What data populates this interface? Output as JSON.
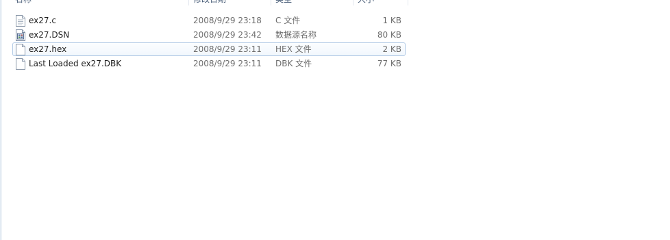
{
  "columns": {
    "name": "名称",
    "date": "修改日期",
    "type": "类型",
    "size": "大小"
  },
  "files": [
    {
      "name": "ex27.c",
      "date": "2008/9/29 23:18",
      "type": "C 文件",
      "size": "1 KB",
      "icon": "text-file-icon",
      "selected": false
    },
    {
      "name": "ex27.DSN",
      "date": "2008/9/29 23:42",
      "type": "数据源名称",
      "size": "80 KB",
      "icon": "dsn-file-icon",
      "selected": false
    },
    {
      "name": "ex27.hex",
      "date": "2008/9/29 23:11",
      "type": "HEX 文件",
      "size": "2 KB",
      "icon": "blank-file-icon",
      "selected": true
    },
    {
      "name": "Last Loaded ex27.DBK",
      "date": "2008/9/29 23:11",
      "type": "DBK 文件",
      "size": "77 KB",
      "icon": "blank-file-icon",
      "selected": false
    }
  ],
  "colors": {
    "selection_border": "#b3cbe6",
    "selection_fill": "#f2f7fd",
    "header_text": "#4c607a",
    "meta_text": "#6d6d6d"
  }
}
